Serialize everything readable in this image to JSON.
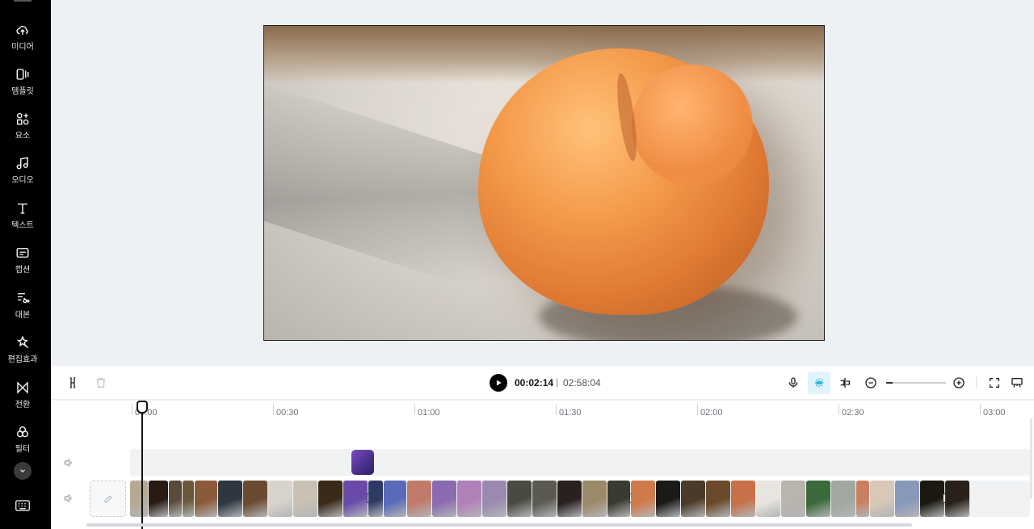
{
  "sidebar": {
    "items": [
      {
        "label": "미디어",
        "icon": "cloud-upload-icon"
      },
      {
        "label": "템플릿",
        "icon": "template-icon"
      },
      {
        "label": "요소",
        "icon": "elements-icon"
      },
      {
        "label": "오디오",
        "icon": "music-note-icon"
      },
      {
        "label": "텍스트",
        "icon": "text-t-icon"
      },
      {
        "label": "캡션",
        "icon": "caption-icon"
      },
      {
        "label": "대본",
        "icon": "script-icon"
      },
      {
        "label": "편집효과",
        "icon": "magic-wand-icon"
      },
      {
        "label": "전환",
        "icon": "transition-icon"
      },
      {
        "label": "필터",
        "icon": "filter-icon"
      }
    ]
  },
  "player": {
    "current_time": "00:02:14",
    "separator": "|",
    "total_time": "02:58:04",
    "zoom_level": 0.1
  },
  "timeline": {
    "ruler": [
      "00:00",
      "00:30",
      "01:00",
      "01:30",
      "02:00",
      "02:30",
      "03:00"
    ],
    "clip_colors": [
      "#b6a994",
      "#2a1a12",
      "#5a4a3a",
      "#6b5a3a",
      "#8a5a3a",
      "#2e3640",
      "#6a4a30",
      "#d8d4cc",
      "#c9c1b4",
      "#3a2a1a",
      "#6a4aa8",
      "#2e3a66",
      "#5a6ab8",
      "#c07a6a",
      "#8a6ab0",
      "#b080b8",
      "#9a8ab0",
      "#4a4a40",
      "#5a5a50",
      "#2a2020",
      "#9a8a6a",
      "#3a3a30",
      "#d07a4a",
      "#1a1a18",
      "#4a3a2a",
      "#6a4a2a",
      "#c87048",
      "#e8e4de",
      "#b8b4ae",
      "#3a6a3a",
      "#a0a8a0",
      "#c88060",
      "#d8c8b8",
      "#8898b8",
      "#1a1810",
      "#2a2018"
    ]
  },
  "colors": {
    "sidebar_bg": "#000000",
    "accent_active": "#e1f4fb",
    "purple_clip": "#6b3fb0"
  }
}
